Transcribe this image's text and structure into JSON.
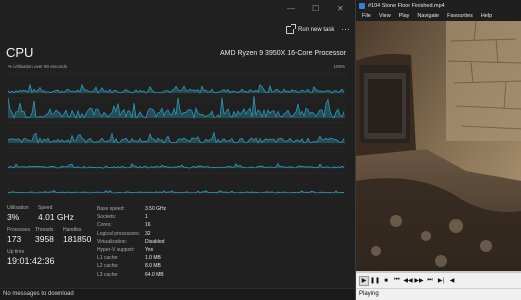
{
  "taskmanager": {
    "run_task_label": "Run new task",
    "more_glyph": "···",
    "title": "CPU",
    "model": "AMD Ryzen 9 3950X 16-Core Processor",
    "util_caption": "% Utilisation over 60 seconds",
    "pct_max": "100%",
    "stats": {
      "utilisation": {
        "label": "Utilisation",
        "value": "3%"
      },
      "speed": {
        "label": "Speed",
        "value": "4.01 GHz"
      },
      "processes": {
        "label": "Processes",
        "value": "173"
      },
      "threads": {
        "label": "Threads",
        "value": "3958"
      },
      "handles": {
        "label": "Handles",
        "value": "181850"
      },
      "uptime": {
        "label": "Up time",
        "value": "19:01:42:36"
      }
    },
    "specs": [
      {
        "k": "Base speed:",
        "v": "3.50 GHz"
      },
      {
        "k": "Sockets:",
        "v": "1"
      },
      {
        "k": "Cores:",
        "v": "16"
      },
      {
        "k": "Logical processors:",
        "v": "32"
      },
      {
        "k": "Virtualisation:",
        "v": "Disabled"
      },
      {
        "k": "Hyper-V support:",
        "v": "Yes"
      },
      {
        "k": "L1 cache:",
        "v": "1.0 MB"
      },
      {
        "k": "L2 cache:",
        "v": "8.0 MB"
      },
      {
        "k": "L3 cache:",
        "v": "64.0 MB"
      }
    ],
    "status": "No messages to download",
    "graph_color": "#2fa3c2"
  },
  "player": {
    "title": "#104 Stone Floor Finished.mp4",
    "menu": [
      "File",
      "View",
      "Play",
      "Navigate",
      "Favourites",
      "Help"
    ],
    "status": "Playing"
  }
}
